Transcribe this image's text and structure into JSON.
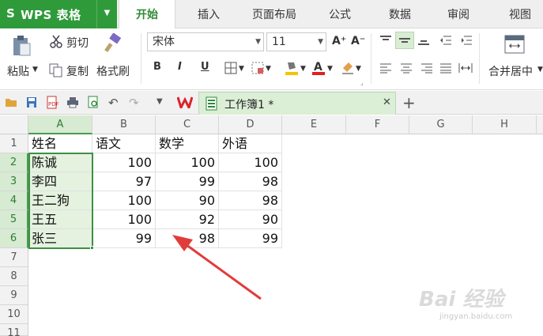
{
  "app": {
    "logo": "S",
    "title": "WPS 表格"
  },
  "tabs": [
    {
      "label": "开始",
      "active": true
    },
    {
      "label": "插入"
    },
    {
      "label": "页面布局"
    },
    {
      "label": "公式"
    },
    {
      "label": "数据"
    },
    {
      "label": "审阅"
    },
    {
      "label": "视图"
    }
  ],
  "ribbon": {
    "cut": "剪切",
    "paste": "粘贴",
    "copy": "复制",
    "format_painter": "格式刷",
    "font_name": "宋体",
    "font_size": "11",
    "bold": "B",
    "italic": "I",
    "underline": "U",
    "merge_center": "合并居中"
  },
  "document_tab": {
    "name": "工作簿1 *"
  },
  "columns": [
    "A",
    "B",
    "C",
    "D",
    "E",
    "F",
    "G",
    "H"
  ],
  "rows": [
    "1",
    "2",
    "3",
    "4",
    "5",
    "6",
    "7",
    "8",
    "9",
    "10",
    "11"
  ],
  "table": {
    "header": [
      "姓名",
      "语文",
      "数学",
      "外语"
    ],
    "data": [
      [
        "陈诚",
        "100",
        "100",
        "100"
      ],
      [
        "李四",
        "97",
        "99",
        "98"
      ],
      [
        "王二狗",
        "100",
        "90",
        "98"
      ],
      [
        "王五",
        "100",
        "92",
        "90"
      ],
      [
        "张三",
        "99",
        "98",
        "99"
      ]
    ]
  },
  "watermark": {
    "main": "Bai 经验",
    "sub": "jingyan.baidu.com"
  },
  "colors": {
    "accent": "#2f9a3a",
    "selection": "#3f8f45",
    "annotation_arrow": "#e23b3b"
  }
}
